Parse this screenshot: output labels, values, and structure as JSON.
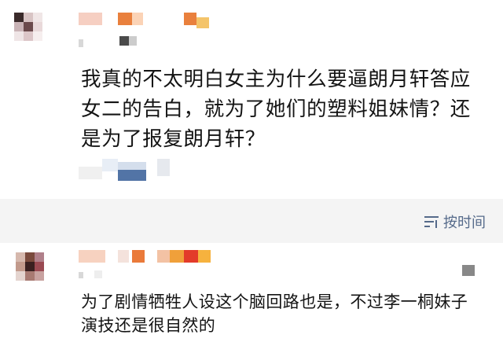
{
  "post": {
    "text": "我真的不太明白女主为什么要逼朗月轩答应女二的告白，就为了她们的塑料姐妹情？还是为了报复朗月轩？"
  },
  "comments_header": {
    "sort_label": "按时间",
    "sort_icon": "sort-lines-icon"
  },
  "comment": {
    "text": "为了剧情牺牲人设这个脑回路也是，不过李一桐妹子演技还是很自然的",
    "more_icon": "more-icon"
  },
  "colors": {
    "accent_link": "#556a8a",
    "text": "#141414",
    "divider_bg": "#f4f4f4"
  }
}
